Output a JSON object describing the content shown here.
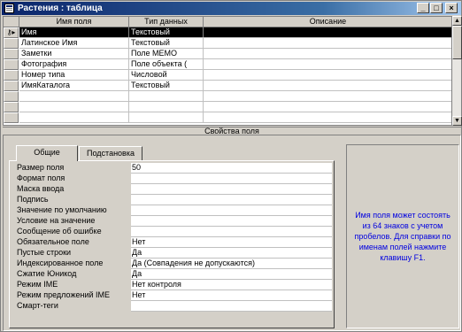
{
  "window": {
    "title": "Растения : таблица",
    "minimize_glyph": "_",
    "maximize_glyph": "□",
    "close_glyph": "×"
  },
  "grid": {
    "headers": [
      "Имя поля",
      "Тип данных",
      "Описание"
    ],
    "key_marker": "⚷▸",
    "rows": [
      {
        "name": "Имя",
        "type": "Текстовый",
        "description": ""
      },
      {
        "name": "Латинское Имя",
        "type": "Текстовый",
        "description": ""
      },
      {
        "name": "Заметки",
        "type": "Поле MEMO",
        "description": ""
      },
      {
        "name": "Фотография",
        "type": "Поле объекта (",
        "description": ""
      },
      {
        "name": "Номер типа",
        "type": "Числовой",
        "description": ""
      },
      {
        "name": "ИмяКаталога",
        "type": "Текстовый",
        "description": ""
      },
      {
        "name": "",
        "type": "",
        "description": ""
      },
      {
        "name": "",
        "type": "",
        "description": ""
      },
      {
        "name": "",
        "type": "",
        "description": ""
      }
    ]
  },
  "scrollbar": {
    "up_glyph": "▲",
    "down_glyph": "▼"
  },
  "field_properties_caption": "Свойства поля",
  "tabs": {
    "general": "Общие",
    "lookup": "Подстановка"
  },
  "properties": [
    {
      "label": "Размер поля",
      "value": "50"
    },
    {
      "label": "Формат поля",
      "value": ""
    },
    {
      "label": "Маска ввода",
      "value": ""
    },
    {
      "label": "Подпись",
      "value": ""
    },
    {
      "label": "Значение по умолчанию",
      "value": ""
    },
    {
      "label": "Условие на значение",
      "value": ""
    },
    {
      "label": "Сообщение об ошибке",
      "value": ""
    },
    {
      "label": "Обязательное поле",
      "value": "Нет"
    },
    {
      "label": "Пустые строки",
      "value": "Да"
    },
    {
      "label": "Индексированное поле",
      "value": "Да (Совпадения не допускаются)"
    },
    {
      "label": "Сжатие Юникод",
      "value": "Да"
    },
    {
      "label": "Режим IME",
      "value": "Нет контроля"
    },
    {
      "label": "Режим предложений IME",
      "value": "Нет"
    },
    {
      "label": "Смарт-теги",
      "value": ""
    }
  ],
  "help_text": "Имя поля может состоять из 64 знаков с учетом пробелов. Для справки по именам полей нажмите клавишу F1."
}
